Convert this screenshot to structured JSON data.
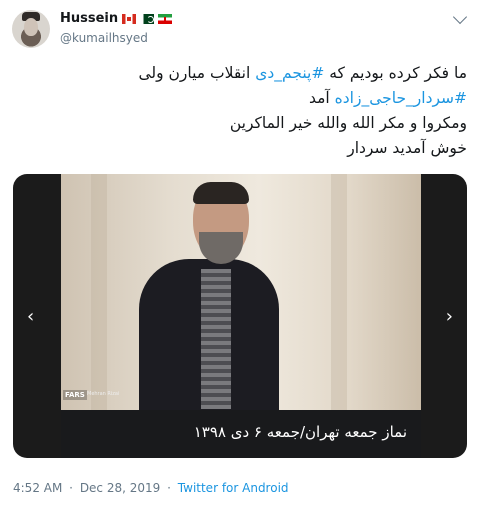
{
  "author": {
    "name": "Hussein",
    "handle": "@kumailhsyed",
    "flags": [
      "flag-canada-icon",
      "flag-pakistan-icon",
      "flag-iran-icon"
    ]
  },
  "tweet": {
    "line1_prefix": "ما فکر کرده بودیم که ",
    "line1_hashtag": "#پنجم_دی",
    "line1_suffix": " انقلاب میارن ولی",
    "line2_hashtag": "#سردار_حاجی_زاده",
    "line2_suffix": " آمد",
    "line3": "ومکروا و مکر الله والله خیر الماکرین",
    "line4": "خوش آمدید سردار"
  },
  "media": {
    "watermark": "FARS",
    "photo_credit": "Mehran Rizai",
    "caption": "نماز جمعه تهران/جمعه ۶ دی ۱۳۹۸",
    "prev_icon": "chevron-left-icon",
    "next_icon": "chevron-right-icon"
  },
  "meta": {
    "time": "4:52 AM",
    "date": "Dec 28, 2019",
    "separator": "·",
    "source": "Twitter for Android"
  },
  "colors": {
    "link": "#1b95e0",
    "secondary_text": "#657786",
    "primary_text": "#14171a"
  }
}
